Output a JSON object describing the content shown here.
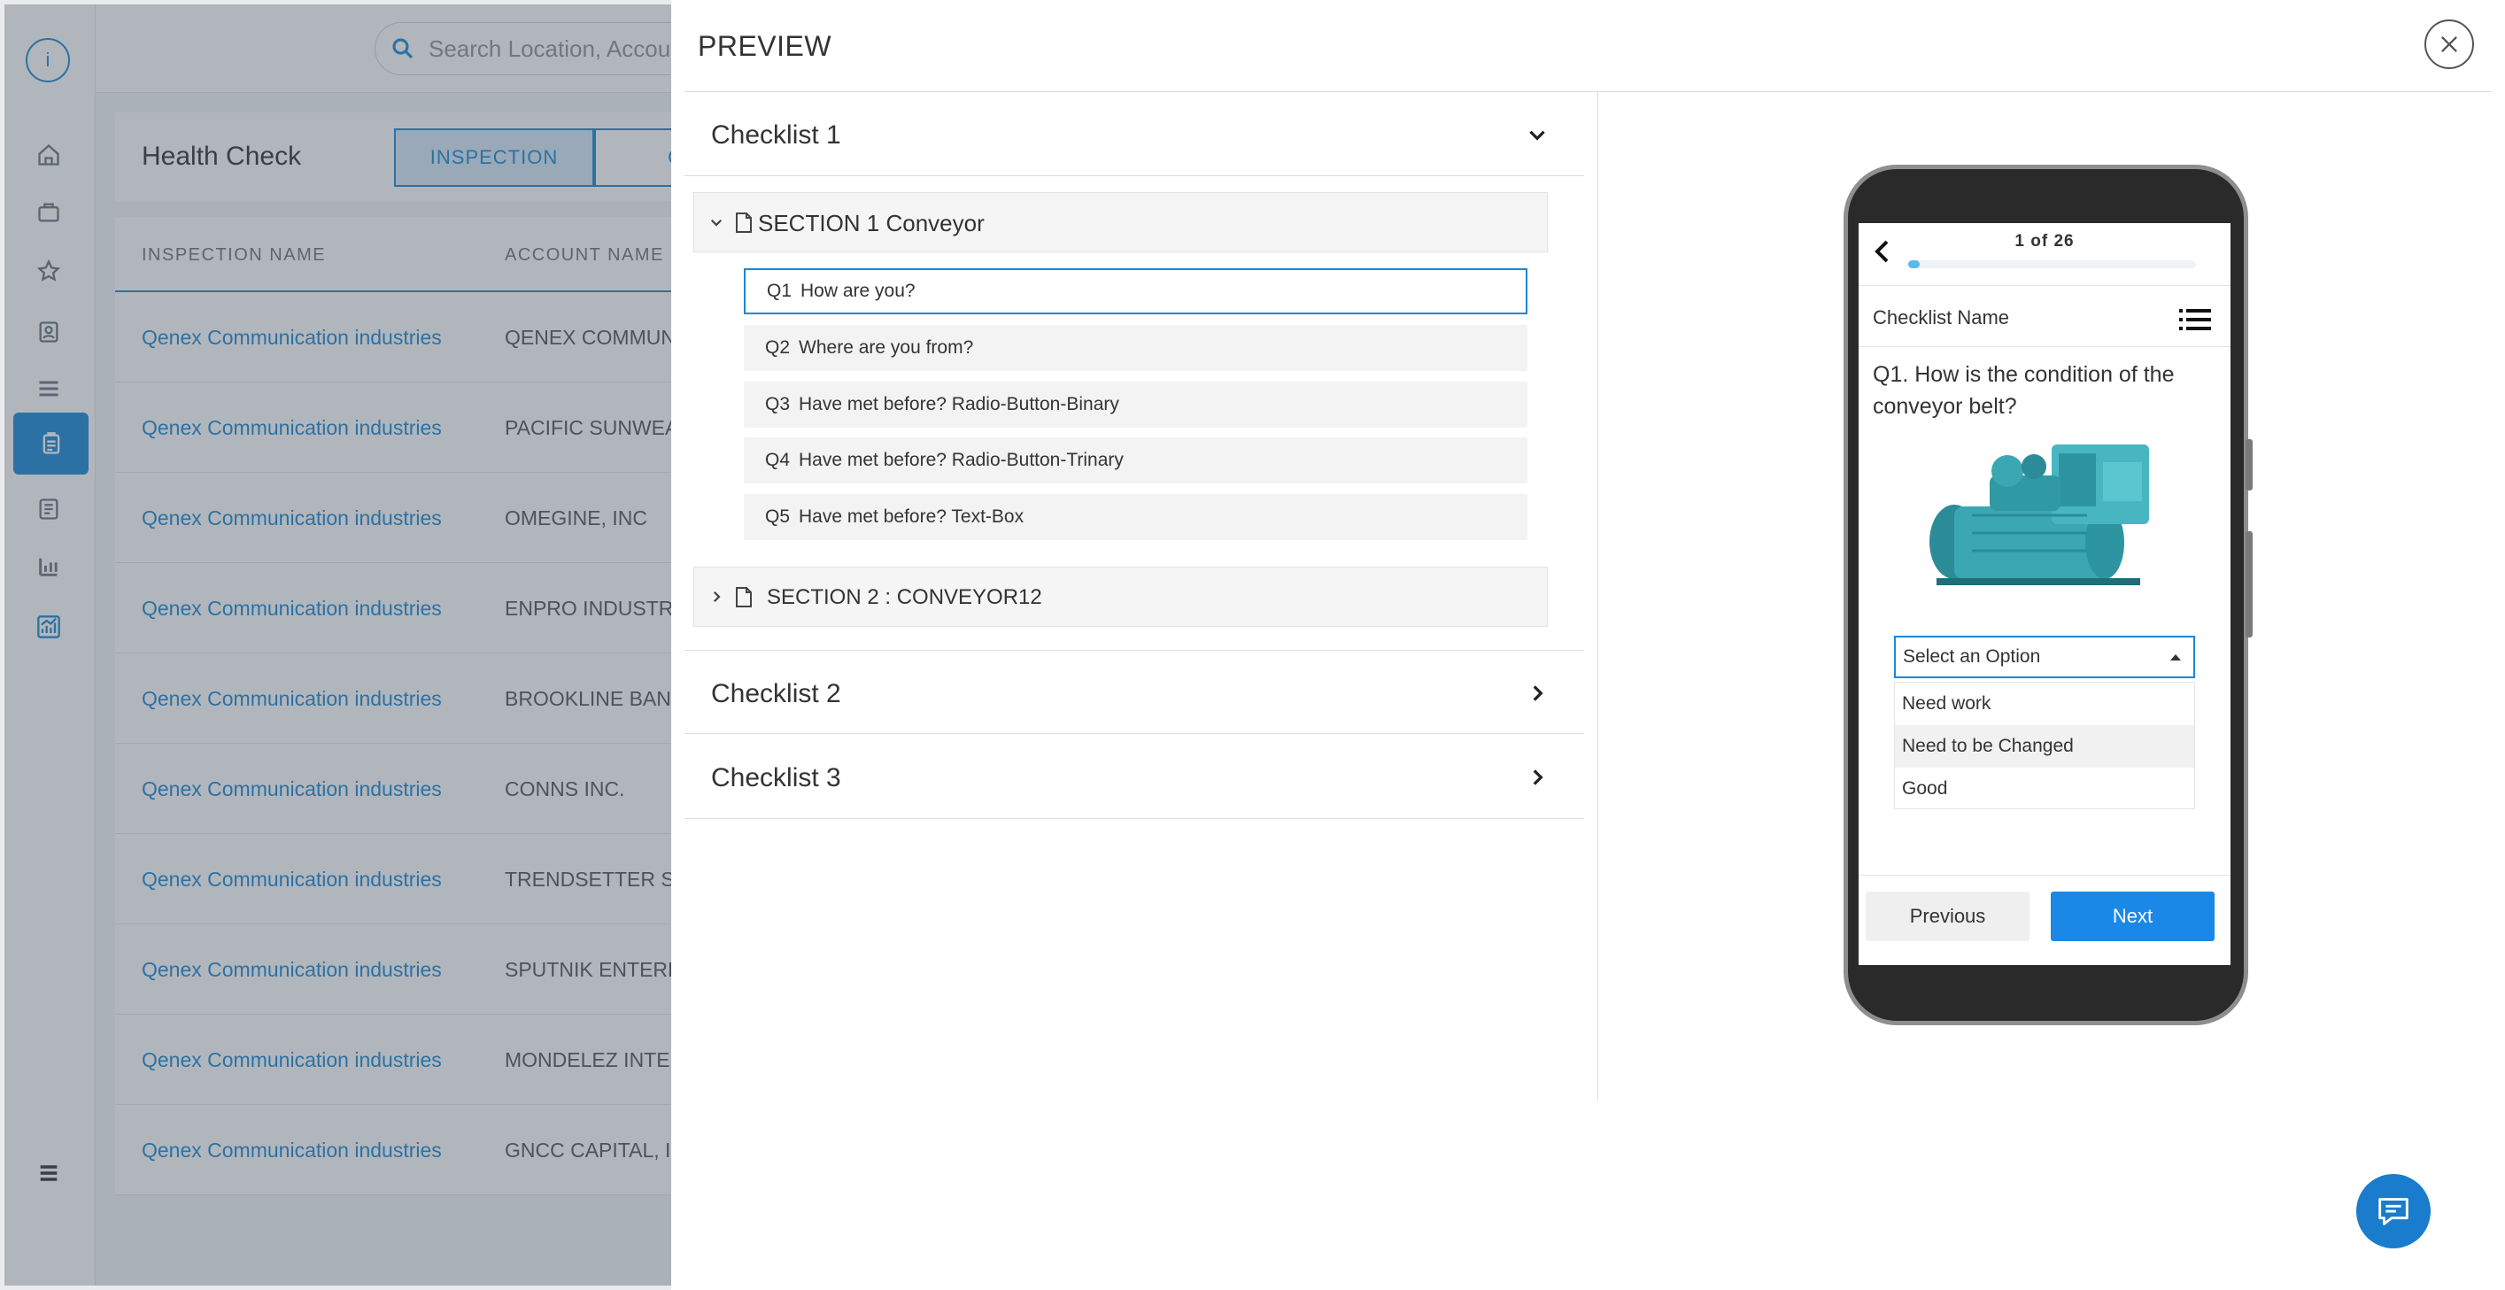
{
  "app": {
    "logo_letter": "i",
    "search_placeholder": "Search Location, Account",
    "page_title": "Health Check",
    "tabs": [
      "INSPECTION",
      "CH"
    ],
    "table": {
      "headers": [
        "INSPECTION NAME",
        "ACCOUNT NAME"
      ],
      "rows": [
        {
          "inspection": "Qenex Communication industries",
          "account": "QENEX COMMUNIC"
        },
        {
          "inspection": "Qenex Communication industries",
          "account": "PACIFIC SUNWEAR"
        },
        {
          "inspection": "Qenex Communication industries",
          "account": "OMEGINE, INC"
        },
        {
          "inspection": "Qenex Communication industries",
          "account": "ENPRO INDUSTRIES"
        },
        {
          "inspection": "Qenex Communication industries",
          "account": "BROOKLINE BANCO"
        },
        {
          "inspection": "Qenex Communication industries",
          "account": "CONNS INC."
        },
        {
          "inspection": "Qenex Communication industries",
          "account": "TRENDSETTER SOL"
        },
        {
          "inspection": "Qenex Communication industries",
          "account": "SPUTNIK ENTERPR"
        },
        {
          "inspection": "Qenex Communication industries",
          "account": "MONDELEZ INTERN"
        },
        {
          "inspection": "Qenex Communication industries",
          "account": "GNCC CAPITAL, INC"
        }
      ]
    }
  },
  "preview": {
    "title": "PREVIEW",
    "checklists": [
      "Checklist 1",
      "Checklist 2",
      "Checklist 3"
    ],
    "sections": [
      "SECTION 1 Conveyor",
      "SECTION 2 :  CONVEYOR12"
    ],
    "questions": [
      {
        "num": "Q1",
        "text": "How are you?"
      },
      {
        "num": "Q2",
        "text": "Where are you from?"
      },
      {
        "num": "Q3",
        "text": "Have met before? Radio-Button-Binary"
      },
      {
        "num": "Q4",
        "text": "Have met before? Radio-Button-Trinary"
      },
      {
        "num": "Q5",
        "text": "Have met before? Text-Box"
      }
    ]
  },
  "phone": {
    "counter": "1 of 26",
    "progress": 0.04,
    "checklist_name": "Checklist Name",
    "question": "Q1. How is the condition of the conveyor belt?",
    "select_value": "Select an Option",
    "options": [
      "Need work",
      "Need to be Changed",
      "Good"
    ],
    "previous_label": "Previous",
    "next_label": "Next"
  },
  "colors": {
    "accent": "#1a88d6",
    "button_primary": "#1a88e6",
    "progress": "#5bb8e8",
    "machine": "#3aa7b3"
  },
  "icons": [
    "home-icon",
    "briefcase-icon",
    "star-icon",
    "contact-icon",
    "list-icon",
    "clipboard-icon",
    "report-icon",
    "bar-chart-icon",
    "analytics-icon",
    "hamburger-icon",
    "search-icon",
    "close-icon",
    "chevron-icon",
    "document-icon",
    "list-menu-icon",
    "chat-icon"
  ]
}
